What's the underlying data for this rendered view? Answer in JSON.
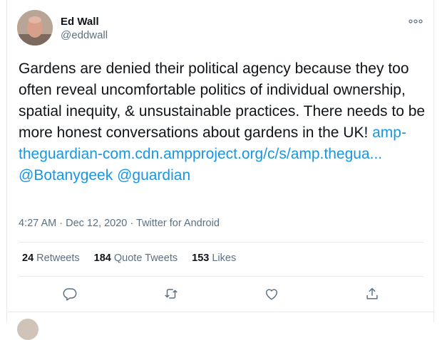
{
  "author": {
    "name": "Ed Wall",
    "handle": "@eddwall"
  },
  "tweet": {
    "text_prefix": "Gardens are denied their political agency because they too often reveal uncomfortable politics of individual ownership, spatial inequity, & unsustainable practices. There needs to be more honest conversations about gardens in the UK! ",
    "link": "amp-theguardian-com.cdn.ampproject.org/c/s/amp.thegua...",
    "mention_botanygeek": "@Botanygeek",
    "mention_guardian": "@guardian"
  },
  "meta": {
    "time": "4:27 AM",
    "date": "Dec 12, 2020",
    "separator": "·",
    "source": "Twitter for Android"
  },
  "stats": {
    "retweets_count": "24",
    "retweets_label": "Retweets",
    "quotes_count": "184",
    "quotes_label": "Quote Tweets",
    "likes_count": "153",
    "likes_label": "Likes"
  },
  "icons": {
    "more": "more-horizontal-icon",
    "reply": "reply-icon",
    "retweet": "retweet-icon",
    "like": "heart-icon",
    "share": "share-icon"
  },
  "colors": {
    "link": "#1b95e0",
    "secondary_text": "#5b7083",
    "divider": "#e6ecf0"
  }
}
